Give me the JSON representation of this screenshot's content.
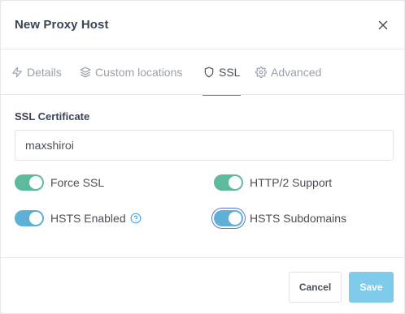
{
  "modal": {
    "title": "New Proxy Host"
  },
  "tabs": [
    {
      "label": "Details",
      "icon": "lightning-icon",
      "active": false
    },
    {
      "label": "Custom locations",
      "icon": "layers-icon",
      "active": false
    },
    {
      "label": "SSL",
      "icon": "shield-icon",
      "active": true
    },
    {
      "label": "Advanced",
      "icon": "gear-icon",
      "active": false
    }
  ],
  "ssl": {
    "certificate_label": "SSL Certificate",
    "certificate_value": "maxshiroi",
    "toggles": {
      "force_ssl": {
        "label": "Force SSL",
        "checked": true
      },
      "http2": {
        "label": "HTTP/2 Support",
        "checked": true
      },
      "hsts": {
        "label": "HSTS Enabled",
        "checked": true
      },
      "hsts_subdomains": {
        "label": "HSTS Subdomains",
        "checked": true
      }
    }
  },
  "footer": {
    "cancel_label": "Cancel",
    "save_label": "Save"
  },
  "colors": {
    "accent": "#467fcf",
    "toggle_green": "#5eba9f",
    "toggle_blue": "#5fb0d7",
    "save_button": "#7ecbec"
  }
}
